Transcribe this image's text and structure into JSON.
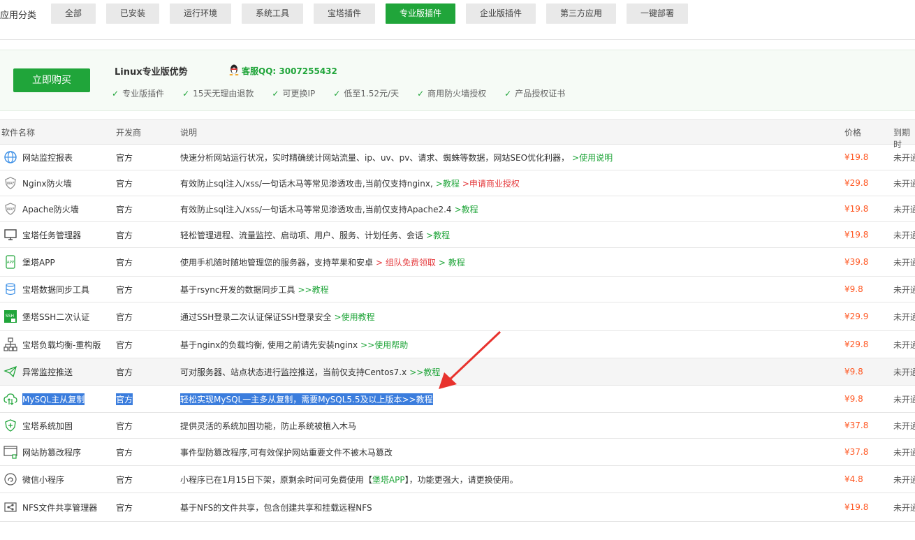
{
  "categories": {
    "label": "应用分类",
    "items": [
      "全部",
      "已安装",
      "运行环境",
      "系统工具",
      "宝塔插件",
      "专业版插件",
      "企业版插件",
      "第三方应用",
      "一键部署"
    ],
    "active_index": 5
  },
  "banner": {
    "buy_label": "立即购买",
    "title": "Linux专业版优势",
    "qq": "客服QQ: 3007255432",
    "features": [
      "专业版插件",
      "15天无理由退款",
      "可更换IP",
      "低至1.52元/天",
      "商用防火墙授权",
      "产品授权证书"
    ]
  },
  "table": {
    "headers": {
      "name": "软件名称",
      "dev": "开发商",
      "desc": "说明",
      "price": "价格",
      "expire": "到期时"
    },
    "rows": [
      {
        "icon": "globe-monitor-icon",
        "name": "网站监控报表",
        "dev": "官方",
        "desc": "快速分析网站运行状况，实时精确统计网站流量、ip、uv、pv、请求、蜘蛛等数据，网站SEO优化利器，",
        "link1": ">使用说明",
        "price": "¥19.8",
        "expire": "未开通"
      },
      {
        "icon": "waf-shield-icon",
        "name": "Nginx防火墙",
        "dev": "官方",
        "desc": "有效防止sql注入/xss/一句话木马等常见渗透攻击,当前仅支持nginx,",
        "link1": ">教程",
        "link2": ">申请商业授权",
        "price": "¥29.8",
        "expire": "未开通"
      },
      {
        "icon": "waf-shield-icon",
        "name": "Apache防火墙",
        "dev": "官方",
        "desc": "有效防止sql注入/xss/一句话木马等常见渗透攻击,当前仅支持Apache2.4",
        "link1": ">教程",
        "price": "¥19.8",
        "expire": "未开通"
      },
      {
        "icon": "monitor-task-icon",
        "name": "宝塔任务管理器",
        "dev": "官方",
        "desc": "轻松管理进程、流量监控、启动项、用户、服务、计划任务、会话",
        "link1": ">教程",
        "price": "¥19.8",
        "expire": "未开通"
      },
      {
        "icon": "app-phone-icon",
        "name": "堡塔APP",
        "dev": "官方",
        "desc": "使用手机随时随地管理您的服务器，支持苹果和安卓",
        "link2": "> 组队免费领取",
        "link1": "> 教程",
        "price": "¥39.8",
        "expire": "未开通"
      },
      {
        "icon": "database-sync-icon",
        "name": "宝塔数据同步工具",
        "dev": "官方",
        "desc": "基于rsync开发的数据同步工具",
        "link1": ">>教程",
        "price": "¥9.8",
        "expire": "未开通"
      },
      {
        "icon": "ssh-lock-icon",
        "name": "堡塔SSH二次认证",
        "dev": "官方",
        "desc": "通过SSH登录二次认证保证SSH登录安全",
        "link1": ">使用教程",
        "price": "¥29.9",
        "expire": "未开通"
      },
      {
        "icon": "network-balance-icon",
        "name": "宝塔负载均衡-重构版",
        "dev": "官方",
        "desc": "基于nginx的负载均衡, 使用之前请先安装nginx",
        "link1": ">>使用帮助",
        "price": "¥29.8",
        "expire": "未开通"
      },
      {
        "icon": "send-alert-icon",
        "name": "异常监控推送",
        "dev": "官方",
        "desc": "可对服务器、站点状态进行监控推送，当前仅支持Centos7.x",
        "link1": ">>教程",
        "price": "¥9.8",
        "expire": "未开通"
      },
      {
        "icon": "cloud-sync-icon",
        "name": "MySQL主从复制",
        "dev": "官方",
        "desc": "轻松实现MySQL一主多从复制，需要MySQL5.5及以上版本>>教程",
        "price": "¥9.8",
        "expire": "未开通"
      },
      {
        "icon": "shield-plus-icon",
        "name": "宝塔系统加固",
        "dev": "官方",
        "desc": "提供灵活的系统加固功能，防止系统被植入木马",
        "price": "¥37.8",
        "expire": "未开通"
      },
      {
        "icon": "window-lock-icon",
        "name": "网站防篡改程序",
        "dev": "官方",
        "desc": "事件型防篡改程序,可有效保护网站重要文件不被木马篡改",
        "price": "¥37.8",
        "expire": "未开通"
      },
      {
        "icon": "miniprogram-icon",
        "name": "微信小程序",
        "dev": "官方",
        "desc": "小程序已在1月15日下架，原剩余时间可免费使用【",
        "link1": "堡塔APP",
        "desc2": "】，功能更强大，请更换使用。",
        "price": "¥4.8",
        "expire": "未开通"
      },
      {
        "icon": "share-folder-icon",
        "name": "NFS文件共享管理器",
        "dev": "官方",
        "desc": "基于NFS的文件共享，包含创建共享和挂载远程NFS",
        "price": "¥19.8",
        "expire": "未开通"
      }
    ]
  },
  "colors": {
    "brand": "#20a53a",
    "price": "#ff5722",
    "link_red": "#e4393c",
    "selection": "#3b7ddd",
    "annotation_arrow": "#e8322d"
  }
}
